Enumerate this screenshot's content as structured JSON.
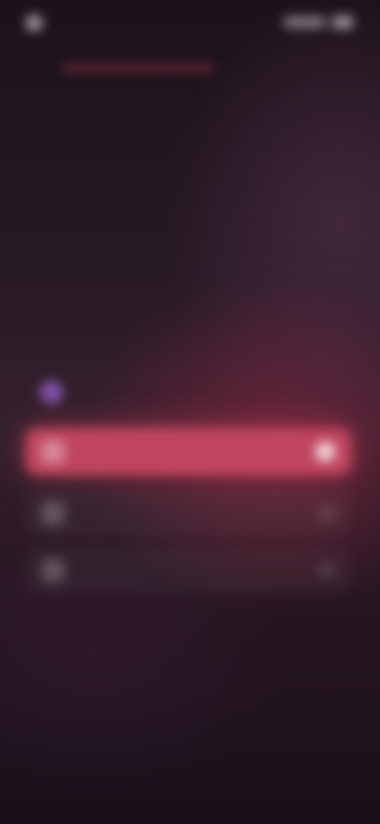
{
  "status_bar": {
    "time": "",
    "icons": [
      "clock-icon",
      "signal-icon",
      "battery-icon"
    ]
  },
  "onboarding": {
    "progress": 1.0,
    "headline": "",
    "subtext": "",
    "info_text": "",
    "info_icon": "sparkle-icon",
    "options": [
      {
        "label": "",
        "icon": "option-icon",
        "selected": true
      },
      {
        "label": "",
        "icon": "option-icon",
        "selected": false
      },
      {
        "label": "",
        "icon": "option-icon",
        "selected": false
      }
    ]
  },
  "colors": {
    "accent": "#c0455f",
    "background": "#1a1118",
    "info_icon": "#8052a8"
  }
}
